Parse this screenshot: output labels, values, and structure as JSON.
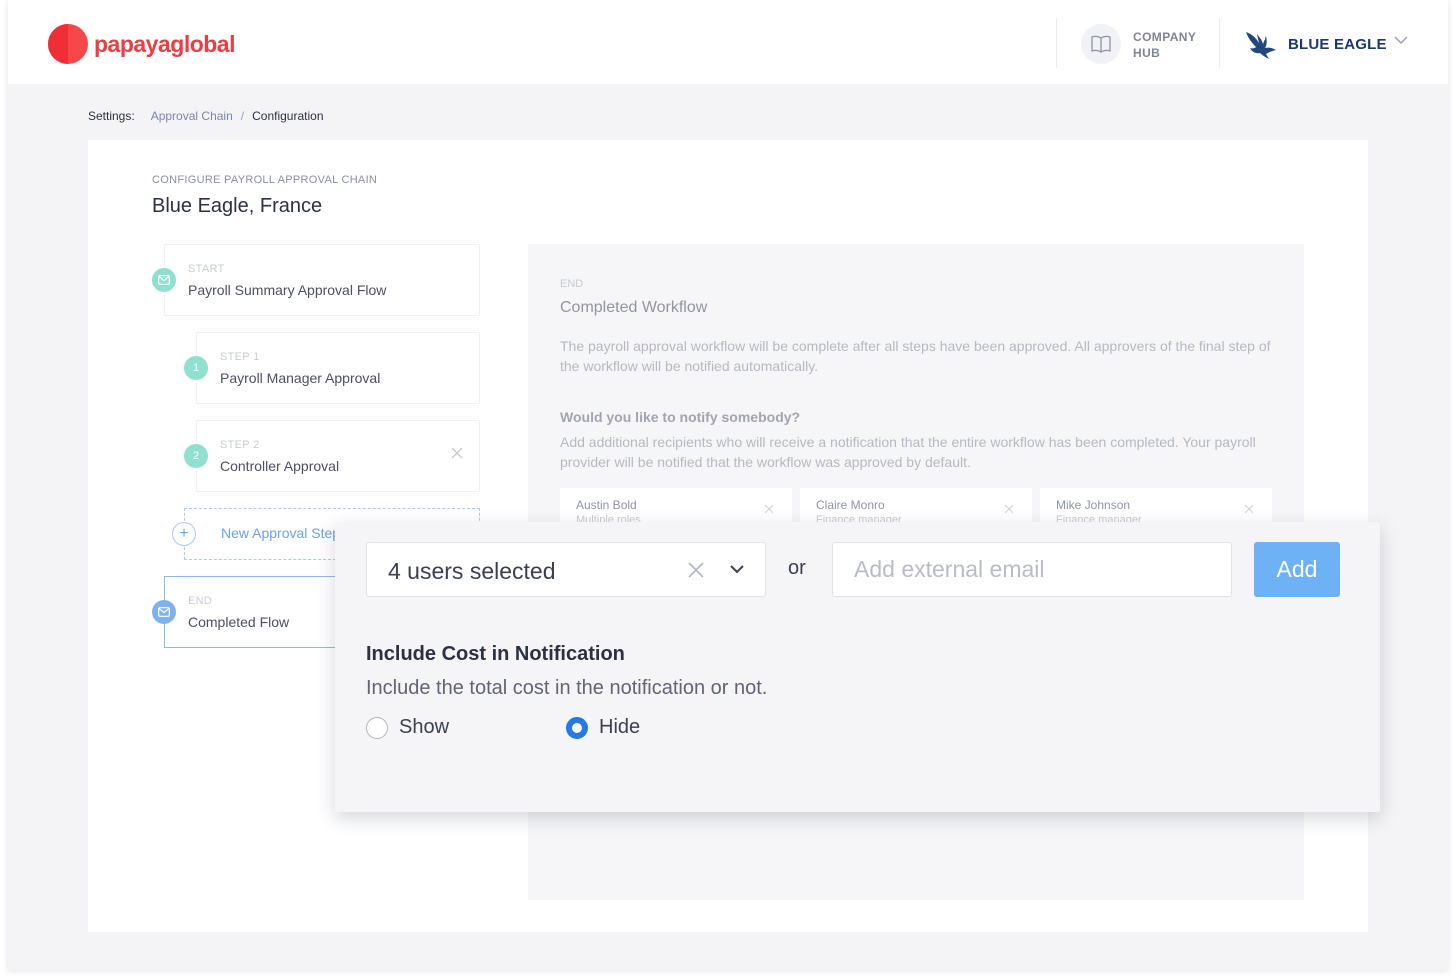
{
  "header": {
    "logo_text": "papayaglobal",
    "company_hub": [
      "COMPANY",
      "HUB"
    ],
    "company_name": "BLUE EAGLE",
    "accent_color": "#ef3c42"
  },
  "breadcrumb": {
    "label": "Settings:",
    "link": "Approval Chain",
    "separator": "/",
    "current": "Configuration"
  },
  "card": {
    "eyebrow": "CONFIGURE PAYROLL APPROVAL CHAIN",
    "title": "Blue Eagle, France"
  },
  "chain": {
    "start": {
      "kicker": "START",
      "name": "Payroll Summary Approval Flow"
    },
    "steps": [
      {
        "number": "1",
        "kicker": "STEP 1",
        "name": "Payroll Manager Approval"
      },
      {
        "number": "2",
        "kicker": "STEP 2",
        "name": "Controller Approval"
      }
    ],
    "new_step_label": "New Approval Step",
    "end": {
      "kicker": "END",
      "name": "Completed Flow"
    }
  },
  "panel": {
    "kicker": "END",
    "title": "Completed Workflow",
    "description": "The payroll approval workflow will be complete after all steps have been approved. All approvers of the final step of the workflow will be notified automatically.",
    "notify_title": "Would you like to notify somebody?",
    "notify_description": "Add additional recipients who will receive a notification that the entire workflow has been completed. Your payroll provider will be notified that the workflow was approved by default.",
    "recipients": [
      {
        "name": "Austin Bold",
        "role": "Multiple roles"
      },
      {
        "name": "Claire Monro",
        "role": "Finance manager"
      },
      {
        "name": "Mike Johnson",
        "role": "Finance manager"
      }
    ]
  },
  "overlay": {
    "users_select_value": "4 users selected",
    "or_label": "or",
    "email_placeholder": "Add external email",
    "add_button": "Add",
    "include_cost_title": "Include Cost in Notification",
    "include_cost_description": "Include the total cost in the notification or not.",
    "options": [
      {
        "label": "Show",
        "selected": false
      },
      {
        "label": "Hide",
        "selected": true
      }
    ]
  }
}
